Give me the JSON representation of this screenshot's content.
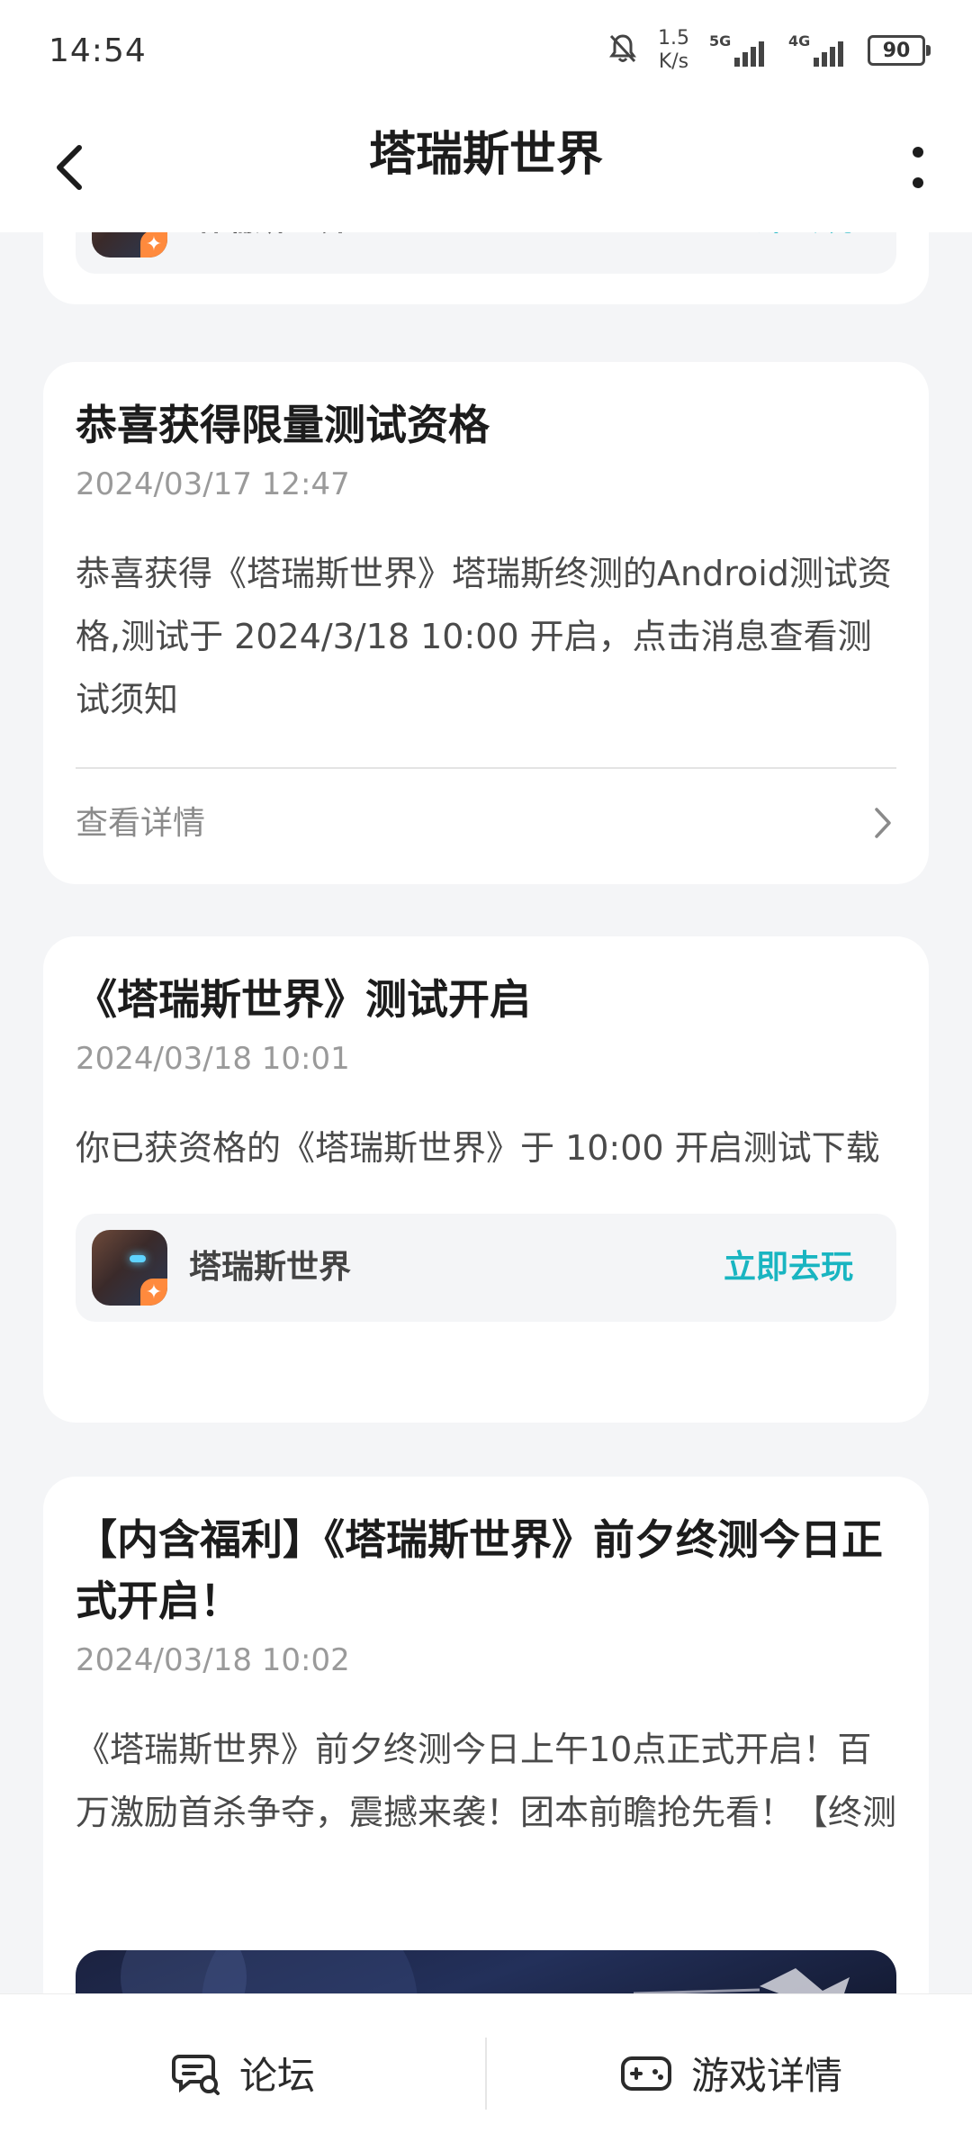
{
  "status_bar": {
    "time": "14:54",
    "net_speed_value": "1.5",
    "net_speed_unit": "K/s",
    "sim1_label": "5G",
    "sim2_label": "4G",
    "battery": "90"
  },
  "header": {
    "title": "塔瑞斯世界"
  },
  "top_partial_card": {
    "game_name": "塔瑞斯世界",
    "play_label": "立即去玩"
  },
  "messages": [
    {
      "title": "恭喜获得限量测试资格",
      "date": "2024/03/17 12:47",
      "body": "恭喜获得《塔瑞斯世界》塔瑞斯终测的Android测试资格,测试于 2024/3/18 10:00 开启，点击消息查看测试须知",
      "detail_label": "查看详情"
    },
    {
      "title": "《塔瑞斯世界》测试开启",
      "date": "2024/03/18 10:01",
      "body": "你已获资格的《塔瑞斯世界》于 10:00 开启测试下载",
      "game_name": "塔瑞斯世界",
      "play_label": "立即去玩"
    },
    {
      "title": "【内含福利】《塔瑞斯世界》前夕终测今日正式开启！",
      "date": "2024/03/18 10:02",
      "body": "《塔瑞斯世界》前夕终测今日上午10点正式开启！百万激励首杀争夺，震撼来袭！团本前瞻抢先看！【终测"
    }
  ],
  "bottom_bar": {
    "forum_label": "论坛",
    "game_detail_label": "游戏详情"
  },
  "colors": {
    "accent": "#19b5c1",
    "background": "#f4f5f7",
    "card": "#ffffff"
  }
}
